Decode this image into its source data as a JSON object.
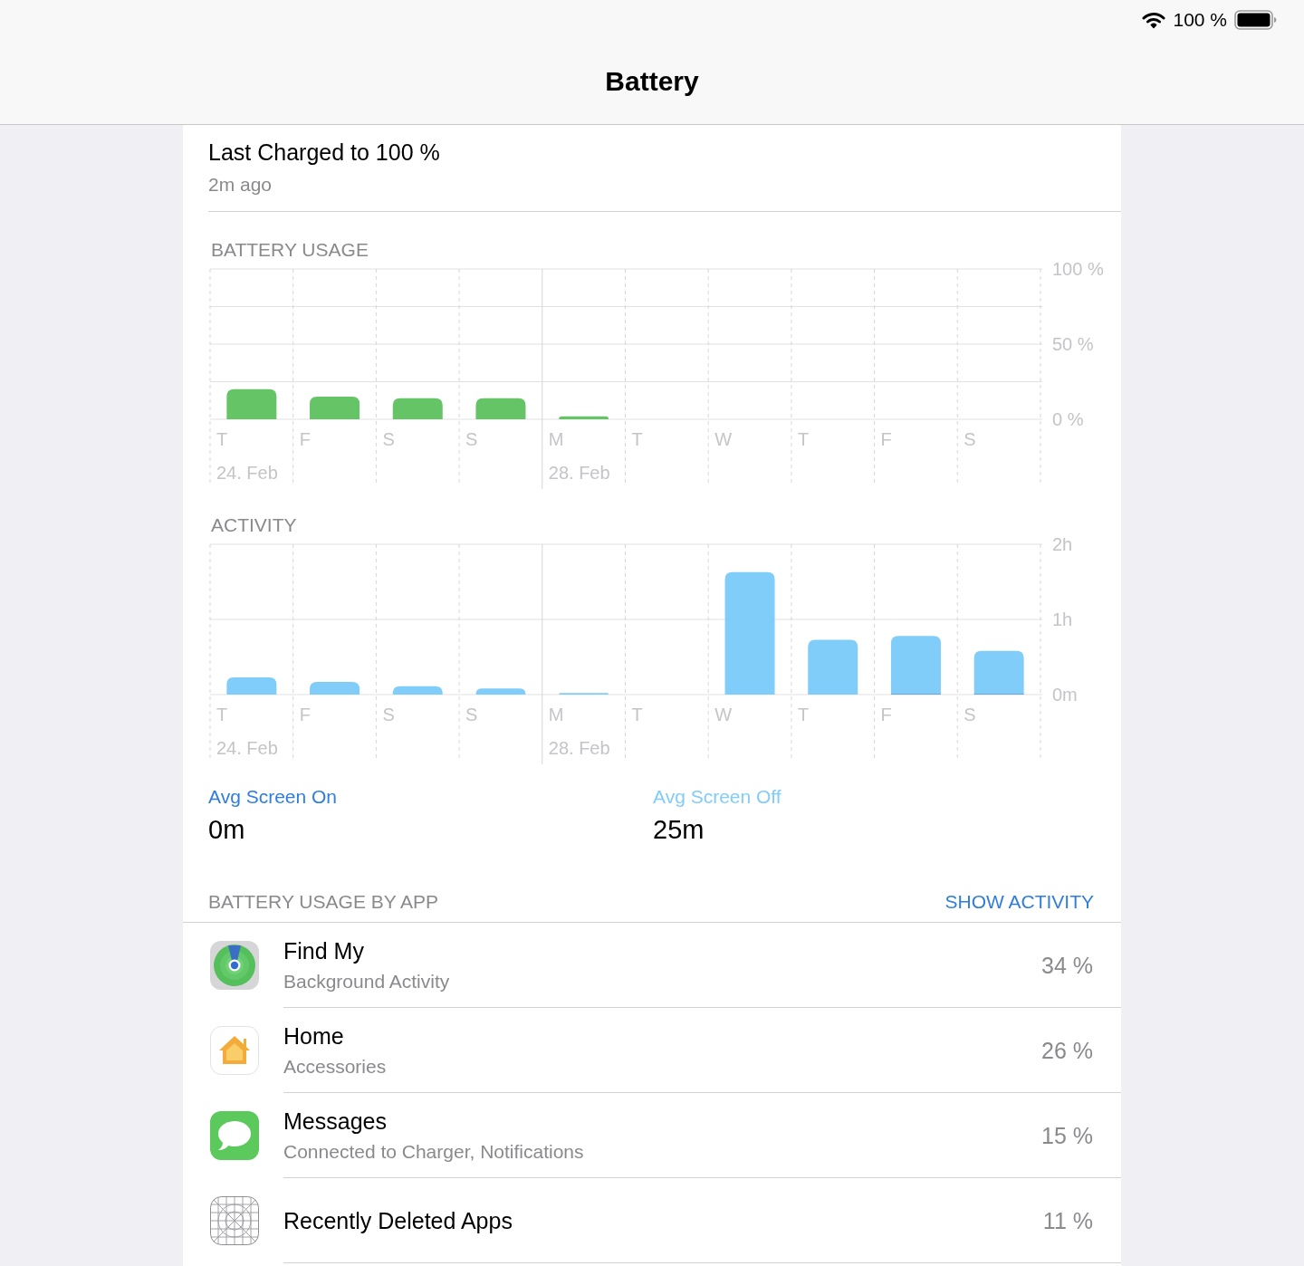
{
  "status_bar": {
    "battery_text": "100 %"
  },
  "header": {
    "title": "Battery"
  },
  "last_charged": {
    "title": "Last Charged to 100 %",
    "subtitle": "2m ago"
  },
  "battery_usage": {
    "title": "BATTERY USAGE",
    "minor_gridlines": true,
    "chart_data": {
      "type": "bar",
      "categories": [
        "T",
        "F",
        "S",
        "S",
        "M",
        "T",
        "W",
        "T",
        "F",
        "S"
      ],
      "series": [
        {
          "color": "#65c466",
          "values": [
            20,
            15,
            14,
            14,
            2,
            null,
            null,
            null,
            null,
            null
          ]
        }
      ],
      "ylim": [
        0,
        100
      ],
      "yticks": [
        {
          "value": 0,
          "label": "0 %"
        },
        {
          "value": 50,
          "label": "50 %"
        },
        {
          "value": 100,
          "label": "100 %"
        }
      ],
      "annotations": [
        "24. Feb"
      ],
      "ref_lines": [
        {
          "axis": "x",
          "value": "M",
          "label": "28. Feb"
        }
      ]
    }
  },
  "activity": {
    "title": "ACTIVITY",
    "chart_data": {
      "type": "bar",
      "stacked": true,
      "categories": [
        "T",
        "F",
        "S",
        "S",
        "M",
        "T",
        "W",
        "T",
        "F",
        "S"
      ],
      "series": [
        {
          "color": "#2f7de1",
          "values": [
            null,
            null,
            null,
            null,
            null,
            null,
            null,
            null,
            0.01,
            0.01
          ]
        },
        {
          "color": "#81cdf9",
          "values": [
            0.23,
            0.17,
            0.11,
            0.08,
            0.02,
            null,
            1.63,
            0.73,
            0.77,
            0.57
          ]
        }
      ],
      "ylim": [
        0,
        2
      ],
      "yticks": [
        {
          "value": 0,
          "label": "0m"
        },
        {
          "value": 1,
          "label": "1h"
        },
        {
          "value": 2,
          "label": "2h"
        }
      ],
      "annotations": [
        "24. Feb"
      ],
      "ref_lines": [
        {
          "axis": "x",
          "value": "M",
          "label": "28. Feb"
        }
      ]
    }
  },
  "averages": [
    {
      "label": "Avg Screen On",
      "value": "0m",
      "color": "#2f7de1"
    },
    {
      "label": "Avg Screen Off",
      "value": "25m",
      "color": "#81cdf9"
    }
  ],
  "app_usage": {
    "title": "BATTERY USAGE BY APP",
    "action": "SHOW ACTIVITY",
    "apps": [
      {
        "kind": "findmy",
        "name": "Find My",
        "detail": "Background Activity",
        "percent": "34 %"
      },
      {
        "kind": "home",
        "name": "Home",
        "detail": "Accessories",
        "percent": "26 %"
      },
      {
        "kind": "messages",
        "name": "Messages",
        "detail": "Connected to Charger, Notifications",
        "percent": "15 %"
      },
      {
        "kind": "deleted",
        "name": "Recently Deleted Apps",
        "percent": "11 %"
      }
    ]
  }
}
